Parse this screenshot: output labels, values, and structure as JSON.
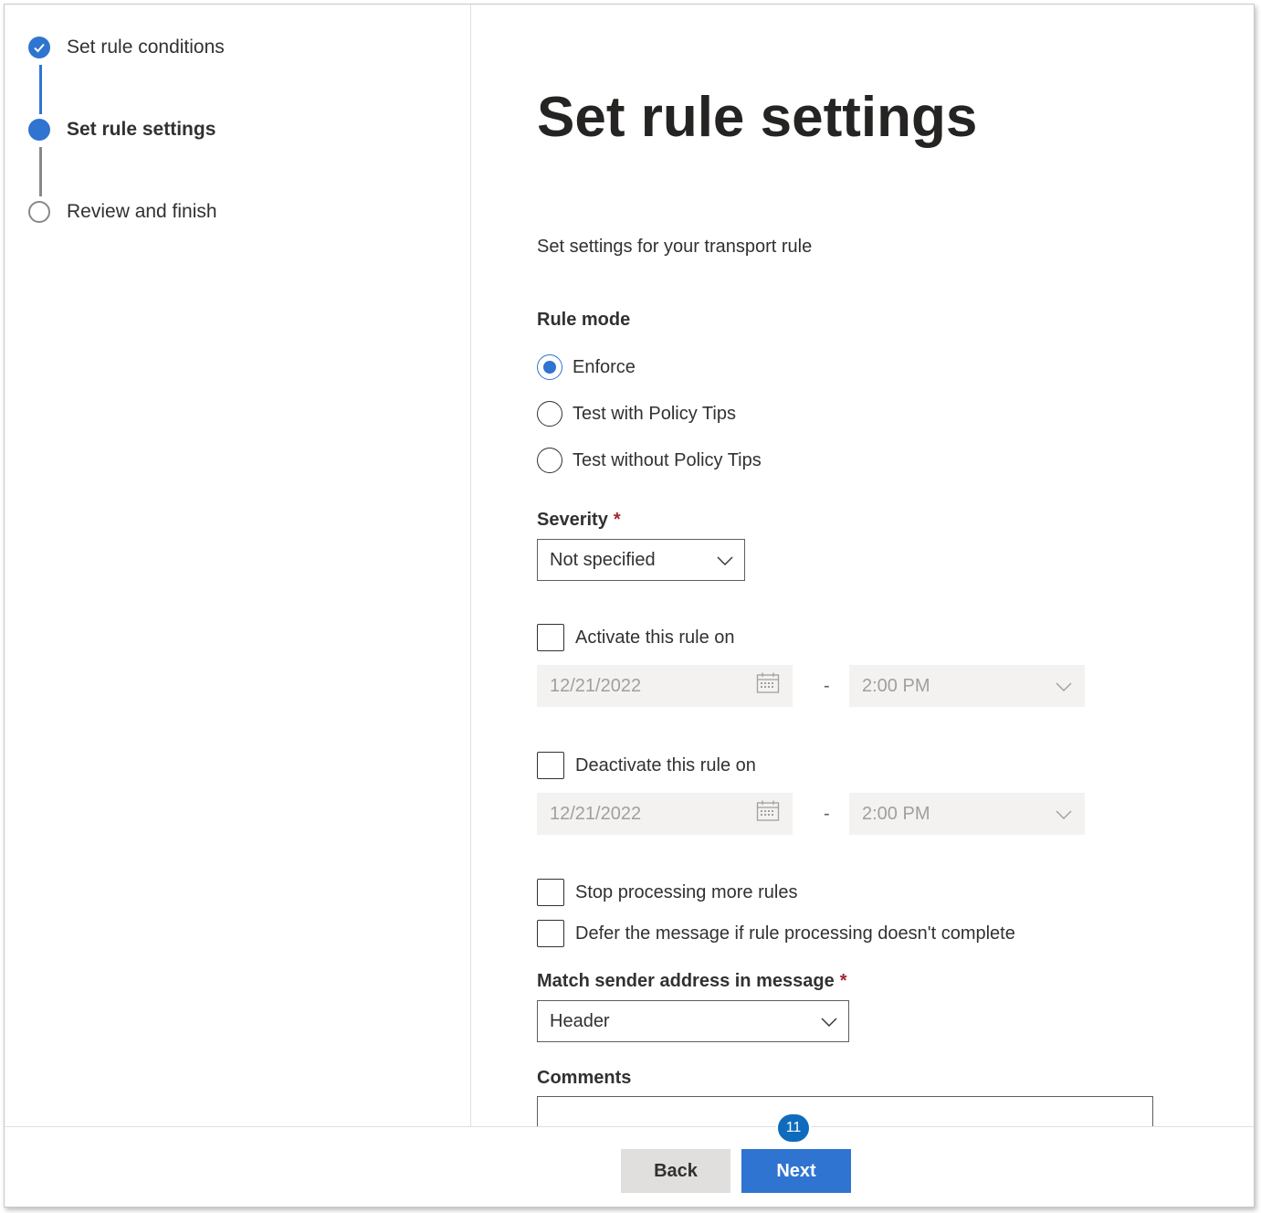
{
  "steps": [
    {
      "label": "Set rule conditions",
      "state": "done"
    },
    {
      "label": "Set rule settings",
      "state": "current"
    },
    {
      "label": "Review and finish",
      "state": "todo"
    }
  ],
  "page": {
    "title": "Set rule settings",
    "description": "Set settings for your transport rule"
  },
  "rule_mode": {
    "label": "Rule mode",
    "options": [
      "Enforce",
      "Test with Policy Tips",
      "Test without Policy Tips"
    ],
    "selected": "Enforce"
  },
  "severity": {
    "label": "Severity",
    "required_mark": "*",
    "value": "Not specified"
  },
  "activate": {
    "label": "Activate this rule on",
    "date": "12/21/2022",
    "separator": "-",
    "time": "2:00 PM"
  },
  "deactivate": {
    "label": "Deactivate this rule on",
    "date": "12/21/2022",
    "separator": "-",
    "time": "2:00 PM"
  },
  "options": {
    "stop_processing": "Stop processing more rules",
    "defer_message": "Defer the message if rule processing doesn't complete"
  },
  "match_sender": {
    "label": "Match sender address in message",
    "required_mark": "*",
    "value": "Header"
  },
  "comments": {
    "label": "Comments"
  },
  "footer": {
    "back_label": "Back",
    "next_label": "Next",
    "badge": "11"
  },
  "colors": {
    "accent": "#2f74d0",
    "required": "#a4262c",
    "badge": "#0f6cbd"
  }
}
